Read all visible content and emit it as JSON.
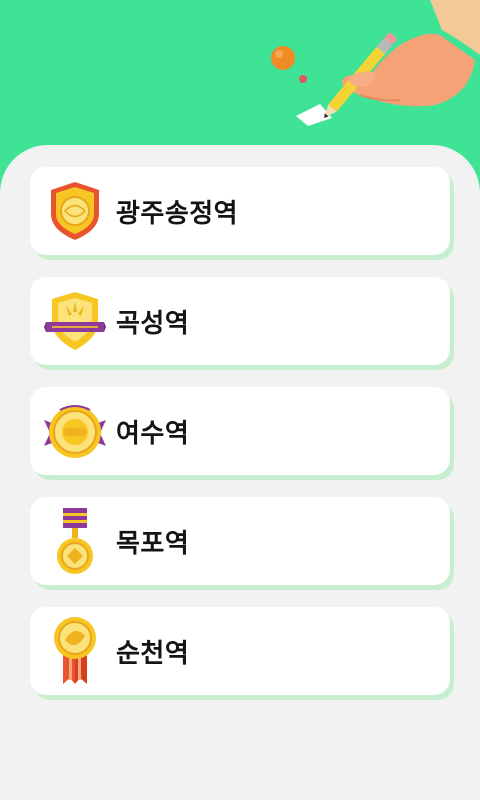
{
  "stations": [
    {
      "label": "광주송정역",
      "badge_icon": "shield-badge-icon"
    },
    {
      "label": "곡성역",
      "badge_icon": "banner-shield-badge-icon"
    },
    {
      "label": "여수역",
      "badge_icon": "winged-coin-badge-icon"
    },
    {
      "label": "목포역",
      "badge_icon": "ribbon-medal-icon"
    },
    {
      "label": "순천역",
      "badge_icon": "gold-medal-icon"
    }
  ],
  "colors": {
    "header_green": "#3fe396",
    "panel_bg": "#f2f2f2",
    "card_shadow": "#c7efcf",
    "gold": "#f7c623",
    "purple": "#8e3a9d",
    "orange_red": "#e8542b"
  }
}
